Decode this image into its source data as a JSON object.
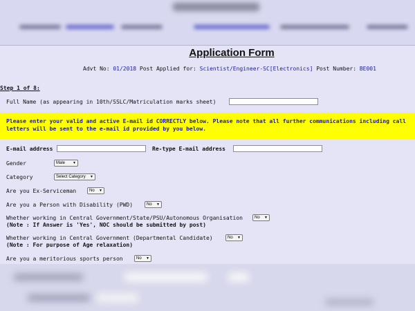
{
  "form": {
    "title": "Application Form",
    "advt_prefix": "Advt No:",
    "advt_no": "01/2018",
    "post_prefix": "Post Applied for:",
    "post": "Scientist/Engineer-SC[Electronics]",
    "post_number_prefix": "Post Number:",
    "post_number": "BE001",
    "step": "Step 1 of 8:"
  },
  "fields": {
    "full_name_label": "Full Name (as appearing in 10th/SSLC/Matriculation marks sheet)",
    "full_name_value": "",
    "notice_line1": "Please enter your valid and active E-mail id CORRECTLY below. Please note that all further communications including call",
    "notice_line2": "letters will be sent to the e-mail id provided by you below.",
    "email_label": "E-mail address",
    "email_value": "",
    "retype_email_label": "Re-type E-mail address",
    "retype_email_value": "",
    "gender_label": "Gender",
    "gender_value": "Male",
    "category_label": "Category",
    "category_value": "Select Category",
    "ex_serviceman_label": "Are you Ex-Serviceman",
    "ex_serviceman_value": "No",
    "pwd_label": "Are you a Person with Disability (PWD)",
    "pwd_value": "No",
    "central_state_label": "Whether working in Central Government/State/PSU/Autonomous Organisation",
    "central_state_value": "No",
    "central_state_note": "(Note : If Answer is 'Yes', NOC should be submitted by post)",
    "central_dept_label": "Whether working in Central Government (Departmental Candidate)",
    "central_dept_value": "No",
    "central_dept_note": "(Note : For purpose of Age relaxation)",
    "sports_label": "Are you a meritorious sports person",
    "sports_value": "No"
  },
  "colors": {
    "background": "#e4e4f6",
    "notice_bg": "#ffff00",
    "link_blue": "#1a1ab0"
  },
  "icons": {
    "dropdown": "chevron-down-icon"
  }
}
